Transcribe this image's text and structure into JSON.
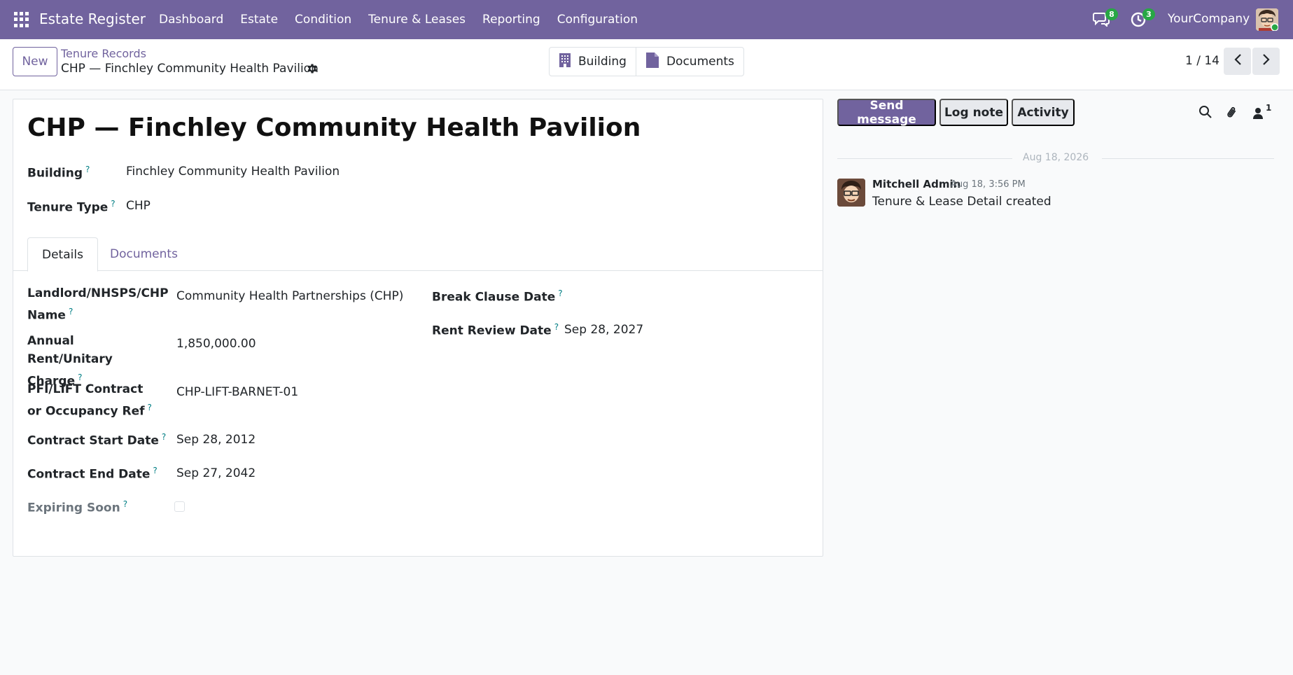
{
  "navbar": {
    "brand": "Estate Register",
    "menu": [
      "Dashboard",
      "Estate",
      "Condition",
      "Tenure & Leases",
      "Reporting",
      "Configuration"
    ],
    "messages_badge": "8",
    "activity_badge": "3",
    "company": "YourCompany"
  },
  "control": {
    "new_label": "New",
    "breadcrumb_parent": "Tenure Records",
    "breadcrumb_current": "CHP — Finchley Community Health Pavilion",
    "smart_buttons": [
      "Building",
      "Documents"
    ],
    "pager": "1 / 14"
  },
  "form": {
    "title": "CHP — Finchley Community Health Pavilion",
    "building_label": "Building",
    "building_value": "Finchley Community Health Pavilion",
    "tenure_type_label": "Tenure Type",
    "tenure_type_value": "CHP",
    "tabs": [
      "Details",
      "Documents"
    ],
    "fields_left": [
      {
        "label": "Landlord/NHSPS/CHP Name",
        "value": "Community Health Partnerships (CHP)"
      },
      {
        "label": "Annual Rent/Unitary Charge",
        "value": "1,850,000.00"
      },
      {
        "label": "PFI/LIFT Contract or Occupancy Ref",
        "value": "CHP-LIFT-BARNET-01"
      },
      {
        "label": "Contract Start Date",
        "value": "Sep 28, 2012"
      },
      {
        "label": "Contract End Date",
        "value": "Sep 27, 2042"
      },
      {
        "label": "Expiring Soon",
        "value": ""
      }
    ],
    "fields_right": [
      {
        "label": "Break Clause Date",
        "value": ""
      },
      {
        "label": "Rent Review Date",
        "value": "Sep 28, 2027"
      }
    ],
    "expiring_soon_checked": false
  },
  "chatter": {
    "send_message": "Send message",
    "log_note": "Log note",
    "activity": "Activity",
    "followers_count": "1",
    "date_separator": "Aug 18, 2026",
    "message": {
      "author": "Mitchell Admin",
      "date": "Aug 18, 3:56 PM",
      "body": "Tenure & Lease Detail created"
    }
  },
  "colors": {
    "brand": "#71639e",
    "badge": "#28a745",
    "help": "#017e84"
  }
}
